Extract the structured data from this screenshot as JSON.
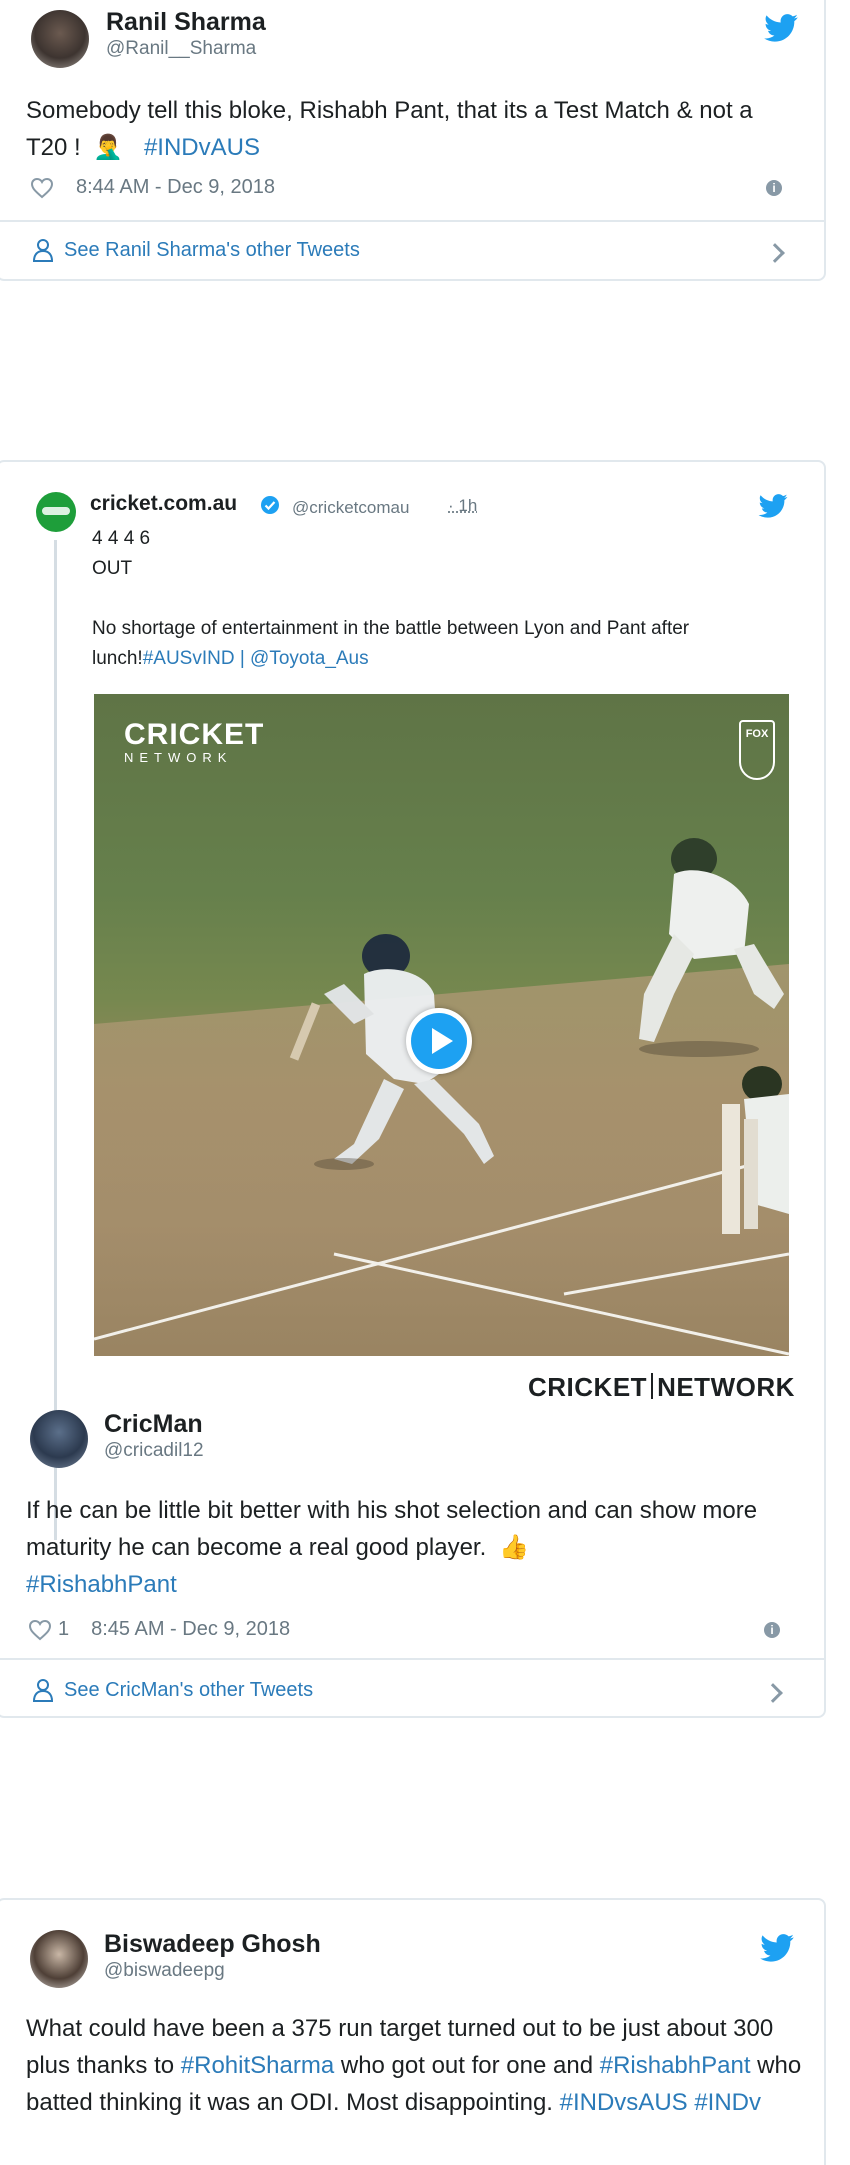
{
  "tweet1": {
    "name": "Ranil Sharma",
    "handle": "@Ranil__Sharma",
    "text": "Somebody tell this bloke, Rishabh Pant, that its a Test Match & not a T20 !",
    "emoji": "🤦‍♂️",
    "hashtag": "#INDvAUS",
    "time": "8:44 AM - Dec 9, 2018",
    "likes": "",
    "footer": "See Ranil Sharma's other Tweets"
  },
  "tweet2": {
    "quoted": {
      "name": "cricket.com.au",
      "handle": "@cricketcomau",
      "age": "· 1h",
      "line1": "4 4 4 6",
      "line2": "OUT",
      "body_a": "No shortage of entertainment in the battle between Lyon and Pant after lunch!",
      "body_link": "#AUSvIND | @Toyota_Aus",
      "video_logo_main": "CRICKET",
      "video_logo_sub": "NETWORK",
      "video_corner_logo": "FOX",
      "video_caption_a": "CRICKET",
      "video_caption_b": "NETWORK"
    },
    "name": "CricMan",
    "handle": "@cricadil12",
    "text": "If he can be little bit better with his shot selection and can show more maturity he can become a real good player.",
    "emoji": "👍",
    "hashtag": "#RishabhPant",
    "likes": "1",
    "time": "8:45 AM - Dec 9, 2018",
    "footer": "See CricMan's other Tweets"
  },
  "tweet3": {
    "name": "Biswadeep Ghosh",
    "handle": "@biswadeepg",
    "text_a": "What could have been a 375 run target turned out to be just about 300 plus thanks to ",
    "link1": "#RohitSharma",
    "text_b": " who got out for one and ",
    "link2": "#RishabhPant",
    "text_c": " who batted thinking it was an ODI. Most disappointing. ",
    "link3": "#INDvsAUS #INDv"
  },
  "colors": {
    "accent": "#2b7bb9",
    "twitter_blue": "#1da1f2",
    "border": "#e1e8ed",
    "muted": "#697882"
  }
}
